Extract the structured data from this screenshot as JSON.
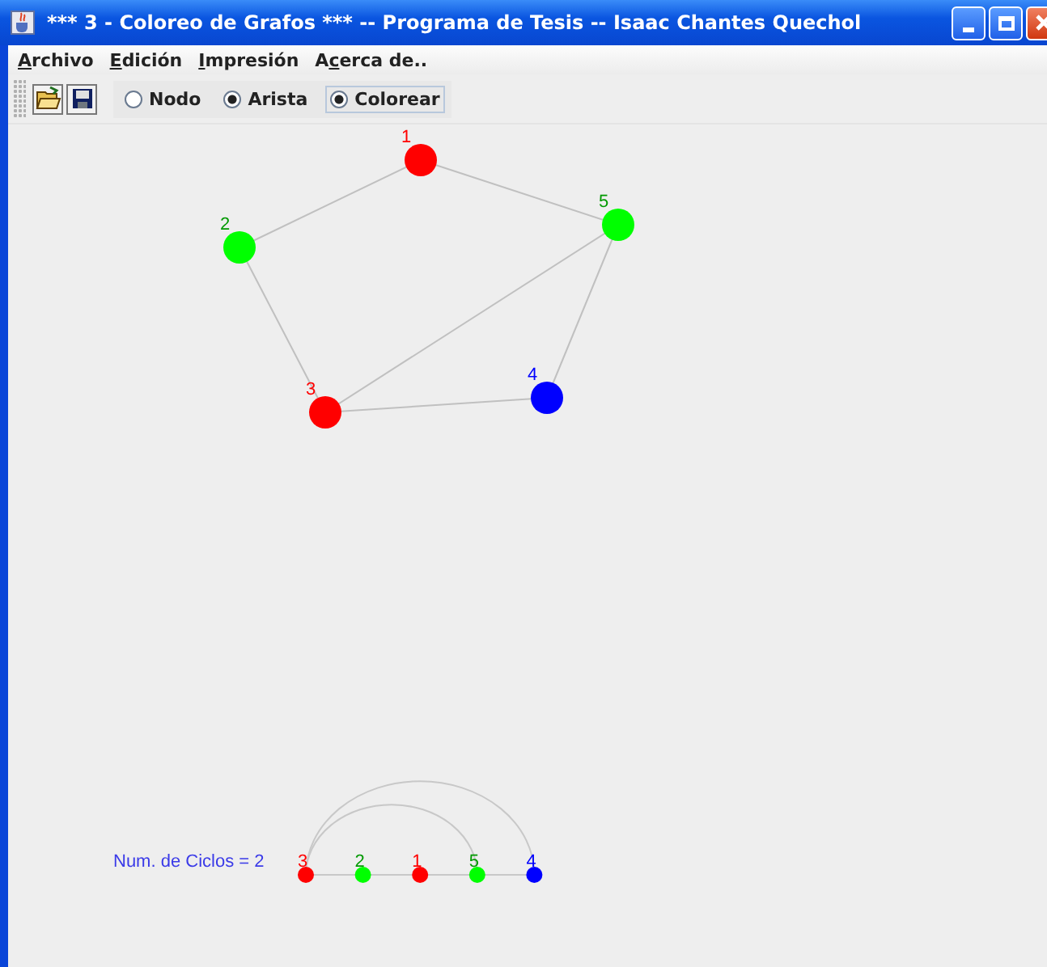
{
  "window": {
    "title": "*** 3 - Coloreo de Grafos *** -- Programa de Tesis -- Isaac Chantes Quechol"
  },
  "menu": [
    {
      "key": "A",
      "post": "rchivo"
    },
    {
      "key": "E",
      "post": "dición"
    },
    {
      "key": "I",
      "post": "mpresión"
    },
    {
      "pre": "A",
      "key": "c",
      "post": "erca de.."
    }
  ],
  "modes": [
    {
      "label": "Nodo",
      "selected": false,
      "focused": false
    },
    {
      "label": "Arista",
      "selected": true,
      "focused": false
    },
    {
      "label": "Colorear",
      "selected": true,
      "focused": true
    }
  ],
  "graph": {
    "nodes": [
      {
        "label": "1",
        "color": "#ff0000"
      },
      {
        "label": "2",
        "color": "#00ff00"
      },
      {
        "label": "3",
        "color": "#ff0000"
      },
      {
        "label": "4",
        "color": "#0000ff"
      },
      {
        "label": "5",
        "color": "#00ff00"
      }
    ]
  },
  "cycles": {
    "label": "Num. de Ciclos = 2",
    "nodes": [
      {
        "label": "3",
        "color": "#ff0000"
      },
      {
        "label": "2",
        "color": "#00ff00"
      },
      {
        "label": "1",
        "color": "#ff0000"
      },
      {
        "label": "5",
        "color": "#00ff00"
      },
      {
        "label": "4",
        "color": "#0000ff"
      }
    ]
  }
}
